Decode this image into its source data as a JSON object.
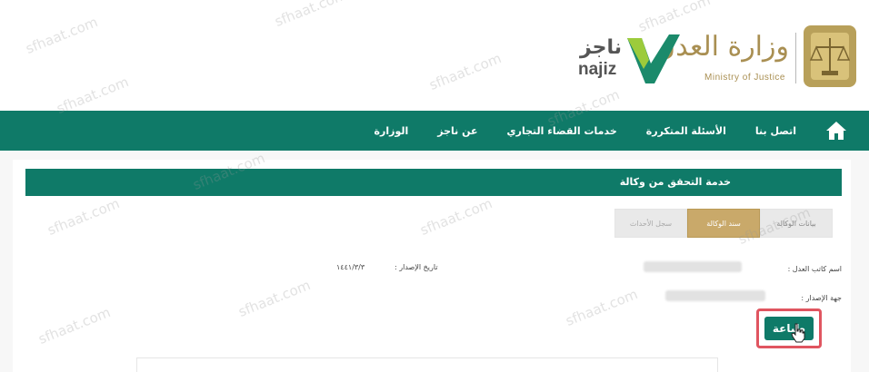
{
  "header": {
    "ministry_ar": "وزارة العدل",
    "ministry_en": "Ministry of Justice",
    "najiz_ar": "ناجز",
    "najiz_en": "najiz"
  },
  "nav": {
    "items": [
      {
        "label": "الوزارة"
      },
      {
        "label": "عن ناجز"
      },
      {
        "label": "خدمات القضاء التجاري"
      },
      {
        "label": "الأسئلة المتكررة"
      },
      {
        "label": "اتصل بنا"
      }
    ]
  },
  "service": {
    "title": "خدمة التحقق من وكالة"
  },
  "tabs": [
    {
      "label": "بيانات الوكالة",
      "state": "partial"
    },
    {
      "label": "سند الوكالة",
      "state": "active"
    },
    {
      "label": "سجل الأحداث",
      "state": "inactive"
    }
  ],
  "fields": {
    "notary_label": "اسم كاتب العدل :",
    "issue_date_label": "تاريخ الإصدار :",
    "issue_date_value": "١٤٤١/٣/٣",
    "issuer_label": "جهة الإصدار :"
  },
  "actions": {
    "print_label": "طباعة"
  },
  "watermark": "sfhaat.com",
  "colors": {
    "primary": "#0f7a68",
    "gold": "#c9a96a",
    "highlight": "#e05560"
  }
}
